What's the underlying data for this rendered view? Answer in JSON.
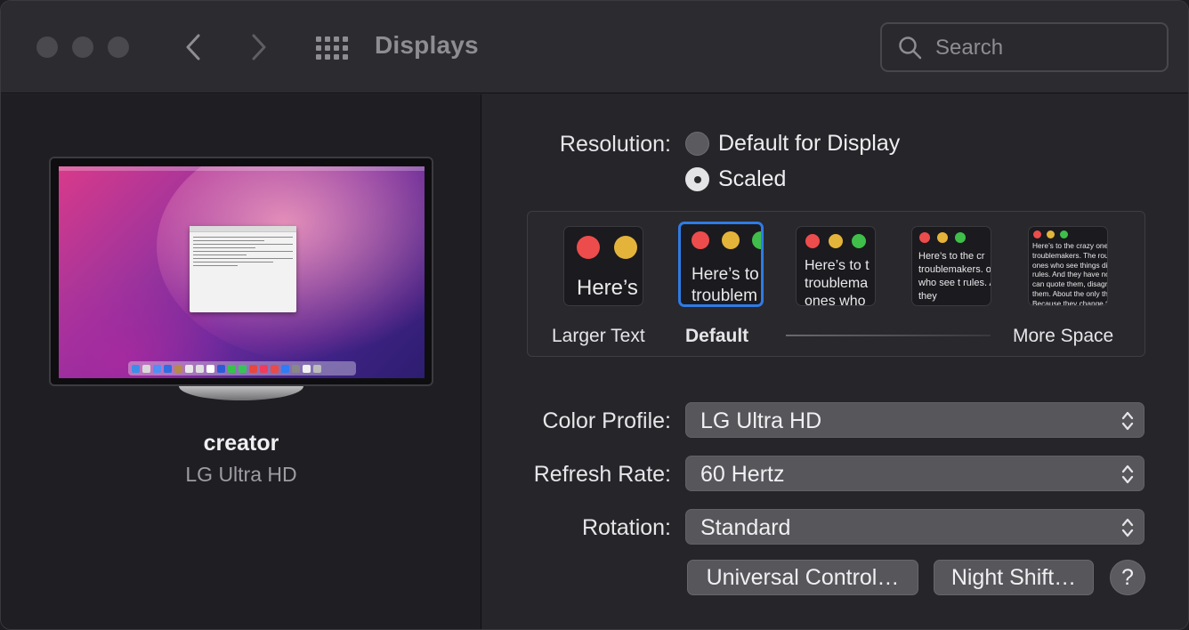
{
  "window": {
    "title": "Displays",
    "search_placeholder": "Search"
  },
  "display": {
    "name": "creator",
    "model": "LG Ultra HD"
  },
  "resolution": {
    "label": "Resolution:",
    "options": [
      {
        "label": "Default for Display",
        "selected": false
      },
      {
        "label": "Scaled",
        "selected": true
      }
    ]
  },
  "scaling": {
    "thumb_texts": [
      "Here’s",
      "Here’s to troublem",
      "Here’s to t troublema ones who",
      "Here’s to the cr troublemakers. ones who see t rules. And they",
      "Here’s to the crazy ones troublemakers. The rou ones who see things dif rules. And they have no can quote them, disagr them. About the only th Because they change th"
    ],
    "selected_index": 1,
    "left_label": "Larger Text",
    "default_label": "Default",
    "right_label": "More Space"
  },
  "color_profile": {
    "label": "Color Profile:",
    "value": "LG Ultra HD"
  },
  "refresh_rate": {
    "label": "Refresh Rate:",
    "value": "60 Hertz"
  },
  "rotation": {
    "label": "Rotation:",
    "value": "Standard"
  },
  "buttons": {
    "universal_control": "Universal Control…",
    "night_shift": "Night Shift…",
    "help": "?"
  },
  "colors": {
    "accent": "#2f7be5",
    "traffic_red": "#ed4c4c",
    "traffic_yellow": "#e4b43a",
    "traffic_green": "#3fbf4a"
  },
  "icons": {
    "back": "chevron-left-icon",
    "forward": "chevron-right-icon",
    "show_all": "grid-icon",
    "search": "magnifier-icon",
    "popup": "up-down-chevron-icon"
  }
}
